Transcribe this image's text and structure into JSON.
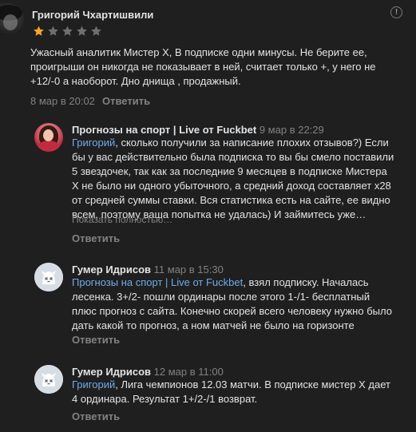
{
  "review": {
    "author": "Григорий Чхартишвили",
    "rating": 1,
    "rating_max": 5,
    "text_lines": [
      "Ужасный аналитик Мистер Х, В подписке одни минусы. Не берите ее,",
      "проигрыши он никогда не показывает в ней, считает только +, у него не",
      "+12/-0 а наоборот. Дно днища , продажный."
    ],
    "date": "8 мар в 20:02",
    "reply_label": "Ответить",
    "info_icon": "!"
  },
  "comments": [
    {
      "author": "Прогнозы на спорт | Live от Fuckbet",
      "date": "9 мар в 22:29",
      "mention": "Григорий",
      "first_line_rest": ", сколько получили за написание плохих отзывов?) Если",
      "text_lines": [
        "бы у вас действительно была подписка то вы бы смело поставили",
        "5 звездочек, так как за последние 9 месяцев в подписке Мистера",
        "Х не было ни одного убыточного, а средний доход составляет х28",
        "от средней суммы ставки. Вся статистика есть на сайте, ее видно",
        "всем, поэтому ваша попытка не удалась) И займитесь уже…"
      ],
      "show_more": "Показать полностью…",
      "reply_label": "Ответить"
    },
    {
      "author": "Гумер Идрисов",
      "date": "11 мар в 15:30",
      "mention": "Прогнозы на спорт | Live от Fuckbet",
      "first_line_rest": ", взял подписку. Началась",
      "text_lines": [
        "лесенка. 3+/2- пошли ординары после этого 1-/1- бесплатный",
        "плюс прогноз с сайта. Конечно скорей всего человеку нужно было",
        "дать какой то прогноз, а ном матчей не было на горизонте"
      ],
      "reply_label": "Ответить"
    },
    {
      "author": "Гумер Идрисов",
      "date": "12 мар в 11:00",
      "mention": "Григорий",
      "first_line_rest": ", Лига чемпионов 12.03 матчи. В подписке мистер Х дает",
      "text_lines": [
        "4 ординара. Результат 1+/2-/1 возврат."
      ],
      "reply_label": "Ответить"
    }
  ],
  "colors": {
    "background": "#1f1f1f",
    "text": "#e1e3e6",
    "muted": "#828282",
    "link": "#71aaeb",
    "star_filled": "#f5a623",
    "star_empty": "#6f6f6f"
  },
  "icons": [
    "info-icon",
    "star-icon",
    "vk-default-avatar-icon"
  ]
}
